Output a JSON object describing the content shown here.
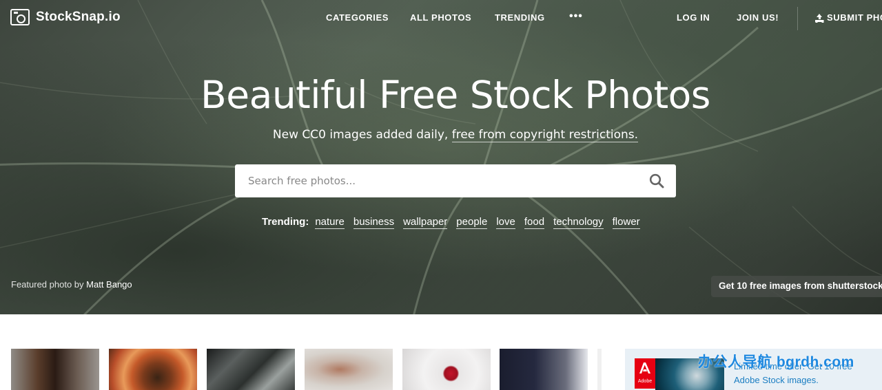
{
  "brand": {
    "name": "StockSnap.io"
  },
  "nav": {
    "categories": "CATEGORIES",
    "all_photos": "ALL PHOTOS",
    "trending": "TRENDING",
    "more": "•••",
    "login": "LOG IN",
    "join": "JOIN US!",
    "submit": "SUBMIT PHO"
  },
  "hero": {
    "title": "Beautiful Free Stock Photos",
    "subtitle_prefix": "New CC0 images added daily,",
    "subtitle_link": "free from copyright restrictions."
  },
  "search": {
    "placeholder": "Search free photos..."
  },
  "trending": {
    "label": "Trending:",
    "tags": [
      "nature",
      "business",
      "wallpaper",
      "people",
      "love",
      "food",
      "technology",
      "flower"
    ]
  },
  "featured": {
    "prefix": "Featured photo by",
    "author": "Matt Bango"
  },
  "promo": {
    "label": "Get 10 free images from shutterstock"
  },
  "ad": {
    "logo_text": "Adobe",
    "line1": "Limited time offer: Get 10 free",
    "line2": "Adobe Stock images."
  },
  "watermark": "办公人导航 bgrdh.com",
  "colors": {
    "link_blue": "#1b7ec2",
    "adobe_red": "#e60012",
    "watermark_blue": "#1f89e0"
  },
  "icons": [
    "camera-logo-icon",
    "upload-icon",
    "search-icon",
    "adobe-logo-icon"
  ]
}
